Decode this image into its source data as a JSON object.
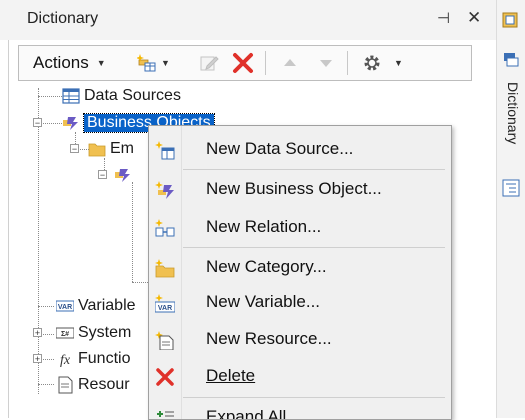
{
  "panel": {
    "title": "Dictionary",
    "pin_glyph": "⊣",
    "close_glyph": "✕"
  },
  "toolbar": {
    "actions_label": "Actions",
    "icons": [
      "new-item-icon",
      "edit-icon",
      "delete-icon",
      "move-up-icon",
      "move-down-icon",
      "settings-icon"
    ]
  },
  "tree": {
    "items": [
      {
        "label": "Data Sources",
        "icon": "data-sources-icon"
      },
      {
        "label": "Business Objects",
        "icon": "business-objects-icon",
        "selected": true
      },
      {
        "label": "Em",
        "icon": "folder-icon"
      },
      {
        "label": "Variable",
        "icon": "variable-icon"
      },
      {
        "label": "System",
        "icon": "system-variables-icon"
      },
      {
        "label": "Functio",
        "icon": "function-icon"
      },
      {
        "label": "Resour",
        "icon": "resource-icon"
      }
    ]
  },
  "side_tab": {
    "label": "Dictionary"
  },
  "context_menu": {
    "items": [
      {
        "label": "New Data Source...",
        "icon": "new-data-source-icon"
      },
      {
        "label": "New Business Object...",
        "icon": "new-business-object-icon"
      },
      {
        "label": "New Relation...",
        "icon": "new-relation-icon"
      },
      {
        "label": "New Category...",
        "icon": "new-category-icon"
      },
      {
        "label": "New Variable...",
        "icon": "new-variable-icon"
      },
      {
        "label": "New Resource...",
        "icon": "new-resource-icon"
      },
      {
        "label": "Delete",
        "icon": "delete-icon"
      },
      {
        "label": "Expand All",
        "icon": "expand-all-icon"
      }
    ]
  },
  "colors": {
    "selection": "#0a63c9",
    "delete_red": "#e0312a",
    "folder": "#f0c050",
    "icon_blue": "#3b6fb5"
  }
}
